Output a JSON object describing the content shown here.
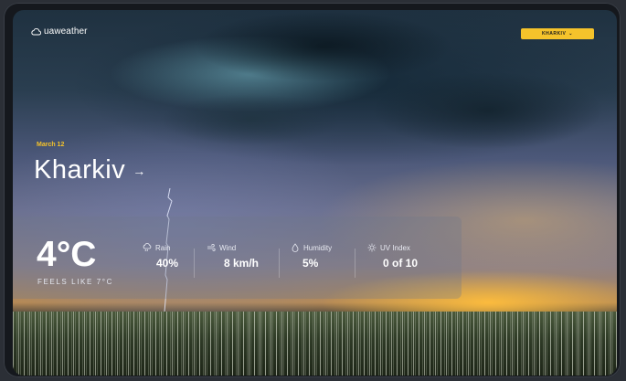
{
  "app": {
    "logo_text": "uaweather"
  },
  "header": {
    "city_button_label": "KHARKIV",
    "city_button_icon": "chevron-down-icon"
  },
  "location": {
    "date": "March 12",
    "city": "Kharkiv",
    "arrow_icon": "arrow-right-icon"
  },
  "current": {
    "temperature": "4°C",
    "feels_like": "FEELS LIKE 7°C",
    "stats": [
      {
        "icon": "rain-icon",
        "label": "Rain",
        "value": "40%"
      },
      {
        "icon": "wind-icon",
        "label": "Wind",
        "value": "8 km/h"
      },
      {
        "icon": "humidity-icon",
        "label": "Humidity",
        "value": "5%"
      },
      {
        "icon": "sun-icon",
        "label": "UV Index",
        "value": "0 of 10"
      }
    ]
  },
  "colors": {
    "accent": "#f5c32b",
    "text": "#ffffff"
  }
}
